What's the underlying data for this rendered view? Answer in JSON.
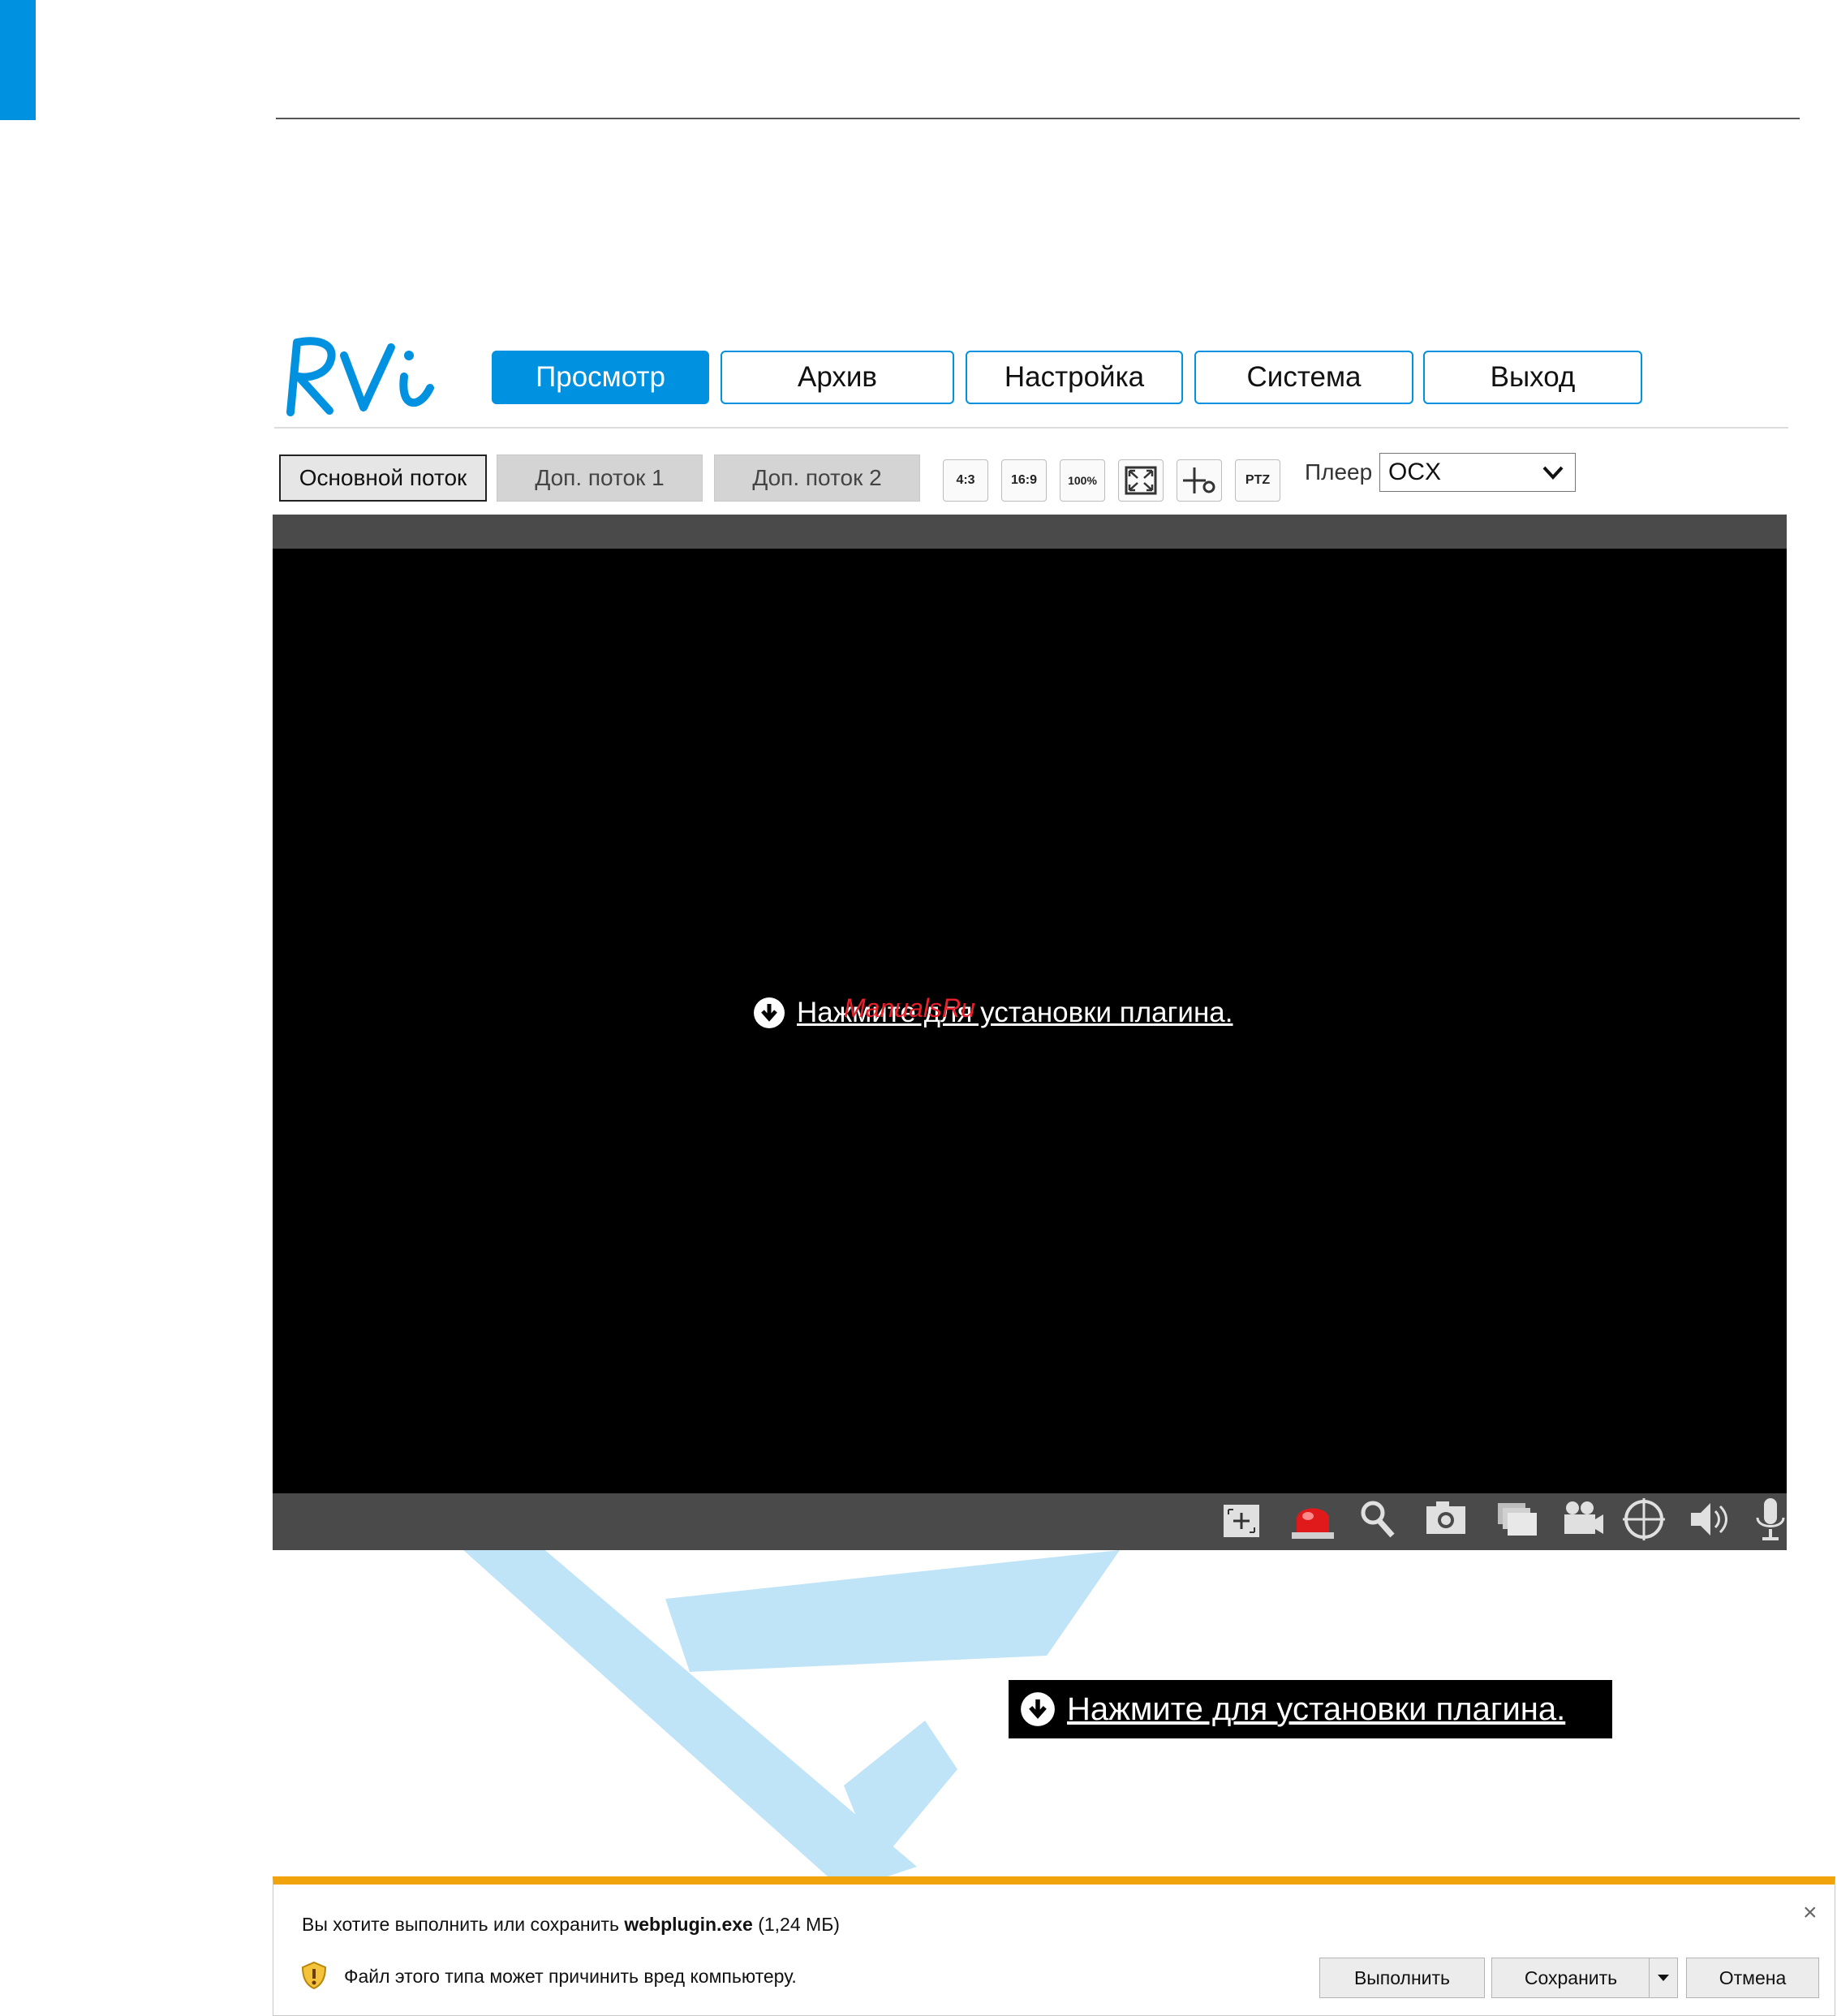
{
  "nav": {
    "items": [
      {
        "label": "Просмотр",
        "active": true
      },
      {
        "label": "Архив",
        "active": false
      },
      {
        "label": "Настройка",
        "active": false
      },
      {
        "label": "Система",
        "active": false
      },
      {
        "label": "Выход",
        "active": false
      }
    ]
  },
  "toolbar": {
    "streams": [
      {
        "label": "Основной поток",
        "active": true
      },
      {
        "label": "Доп. поток 1",
        "active": false
      },
      {
        "label": "Доп. поток 2",
        "active": false
      }
    ],
    "aspect_4_3": "4:3",
    "aspect_16_9": "16:9",
    "zoom_100": "100%",
    "ptz": "PTZ",
    "player_label": "Плеер",
    "player_value": "OCX"
  },
  "video": {
    "plugin_link": "Нажмите для установки плагина.",
    "overlay_watermark": "ManualsRu"
  },
  "plugin_link_sample": "Нажмите для установки плагина.",
  "download_bar": {
    "question_prefix": "Вы хотите выполнить или сохранить ",
    "file_name": "webplugin.exe",
    "file_size": " (1,24 МБ)",
    "warning": "Файл этого типа может причинить вред компьютеру.",
    "run_label": "Выполнить",
    "save_label": "Сохранить",
    "cancel_label": "Отмена",
    "close_glyph": "×"
  },
  "colors": {
    "accent": "#0091e0",
    "download_bar_top": "#f0a30a",
    "record_red": "#e8202a"
  }
}
